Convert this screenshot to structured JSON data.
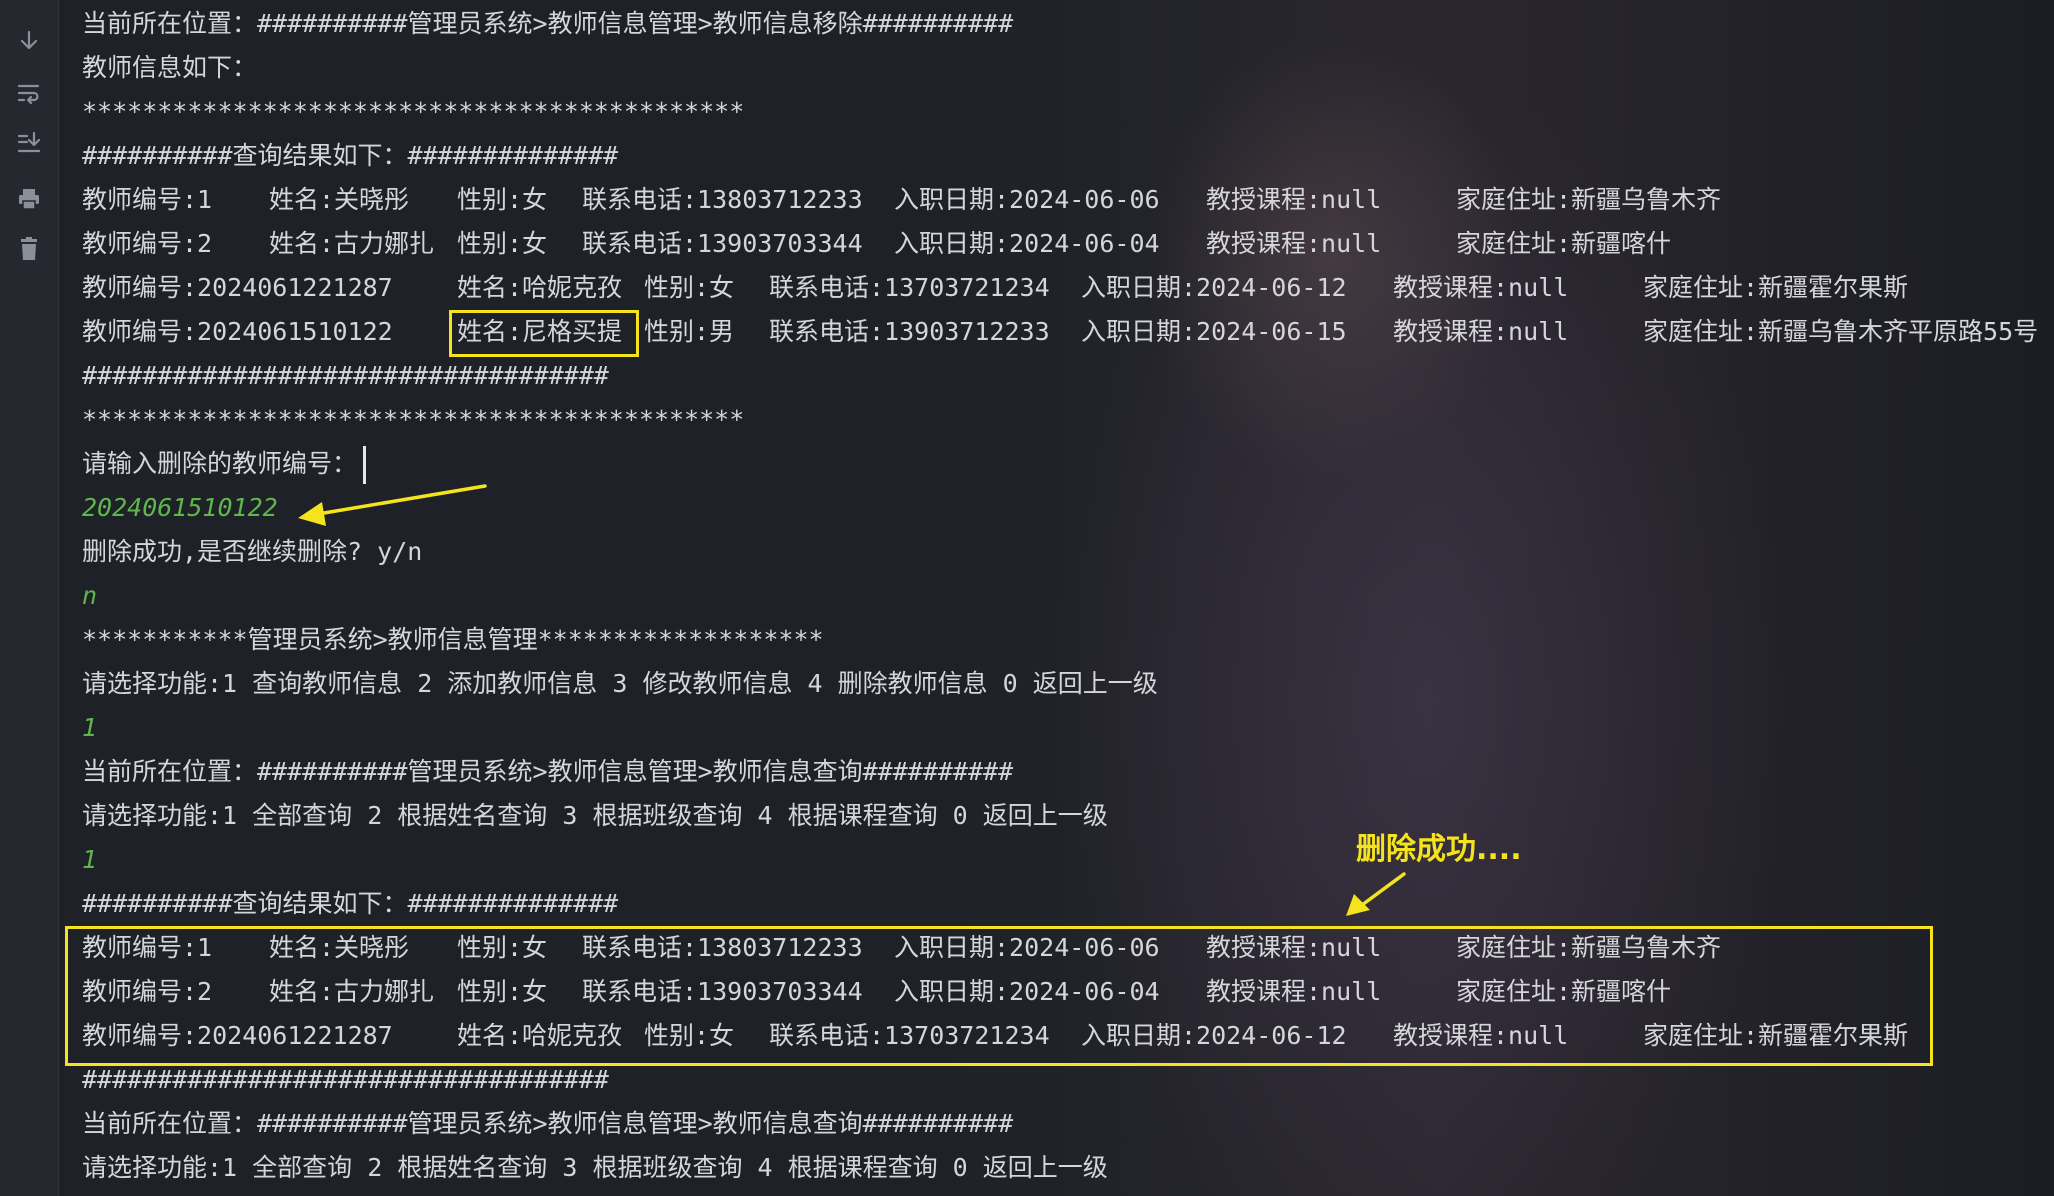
{
  "gutter": {
    "icons": [
      "arrow-down-icon",
      "soft-wrap-icon",
      "scroll-to-end-icon",
      "print-icon",
      "trash-icon"
    ]
  },
  "console": {
    "location_delete": "当前所在位置：##########管理员系统>教师信息管理>教师信息移除##########",
    "info_heading": "教师信息如下：",
    "stars_line": "********************************************",
    "result_heading": "##########查询结果如下：##############",
    "hash_line": "###################################",
    "teachers_before": [
      {
        "id": "教师编号:1",
        "name": "姓名:关晓彤",
        "gender": "性别:女",
        "phone": "联系电话:13803712233",
        "date": "入职日期:2024-06-06",
        "course": "教授课程:null",
        "address": "家庭住址:新疆乌鲁木齐"
      },
      {
        "id": "教师编号:2",
        "name": "姓名:古力娜扎",
        "gender": "性别:女",
        "phone": "联系电话:13903703344",
        "date": "入职日期:2024-06-04",
        "course": "教授课程:null",
        "address": "家庭住址:新疆喀什"
      },
      {
        "id": "教师编号:2024061221287",
        "name": "姓名:哈妮克孜",
        "gender": "性别:女",
        "phone": "联系电话:13703721234",
        "date": "入职日期:2024-06-12",
        "course": "教授课程:null",
        "address": "家庭住址:新疆霍尔果斯"
      },
      {
        "id": "教师编号:2024061510122",
        "name": "姓名:尼格买提",
        "gender": "性别:男",
        "phone": "联系电话:13903712233",
        "date": "入职日期:2024-06-15",
        "course": "教授课程:null",
        "address": "家庭住址:新疆乌鲁木齐平原路55号"
      }
    ],
    "prompt_delete_id": "请输入删除的教师编号：",
    "input_delete_id": "2024061510122",
    "delete_success_prompt": "删除成功,是否继续删除? y/n",
    "input_continue": "n",
    "menu_title": "***********管理员系统>教师信息管理*******************",
    "menu_options": "请选择功能:1 查询教师信息 2 添加教师信息 3 修改教师信息 4 删除教师信息 0 返回上一级",
    "input_menu": "1",
    "location_query": "当前所在位置：##########管理员系统>教师信息管理>教师信息查询##########",
    "query_options": "请选择功能:1 全部查询 2 根据姓名查询 3 根据班级查询 4 根据课程查询 0 返回上一级",
    "input_query": "1",
    "teachers_after": [
      {
        "id": "教师编号:1",
        "name": "姓名:关晓彤",
        "gender": "性别:女",
        "phone": "联系电话:13803712233",
        "date": "入职日期:2024-06-06",
        "course": "教授课程:null",
        "address": "家庭住址:新疆乌鲁木齐"
      },
      {
        "id": "教师编号:2",
        "name": "姓名:古力娜扎",
        "gender": "性别:女",
        "phone": "联系电话:13903703344",
        "date": "入职日期:2024-06-04",
        "course": "教授课程:null",
        "address": "家庭住址:新疆喀什"
      },
      {
        "id": "教师编号:2024061221287",
        "name": "姓名:哈妮克孜",
        "gender": "性别:女",
        "phone": "联系电话:13703721234",
        "date": "入职日期:2024-06-12",
        "course": "教授课程:null",
        "address": "家庭住址:新疆霍尔果斯"
      }
    ]
  },
  "annotation": {
    "label": "删除成功....",
    "color": "#f4e31d"
  },
  "colors": {
    "console_text": "#d4d6da",
    "user_input": "#5fb64a",
    "background": "#1e2127"
  }
}
